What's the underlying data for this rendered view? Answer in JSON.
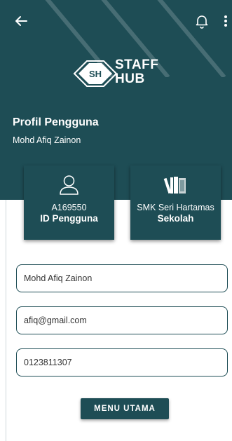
{
  "header": {
    "logo": {
      "initials": "SH",
      "line1": "STAFF",
      "line2": "HUB"
    },
    "title": "Profil Pengguna",
    "subtitle": "Mohd Afiq Zainon",
    "background_color": "#1e4d55"
  },
  "icons": {
    "back": "arrow-left-icon",
    "notifications": "bell-icon",
    "more": "more-vertical-icon",
    "user": "user-icon",
    "school": "books-icon"
  },
  "cards": [
    {
      "value": "A169550",
      "label": "ID Pengguna"
    },
    {
      "value": "SMK Seri Hartamas",
      "label": "Sekolah"
    }
  ],
  "form": {
    "name": "Mohd Afiq Zainon",
    "email": "afiq@gmail.com",
    "phone": "0123811307"
  },
  "button": {
    "label": "MENU UTAMA"
  }
}
